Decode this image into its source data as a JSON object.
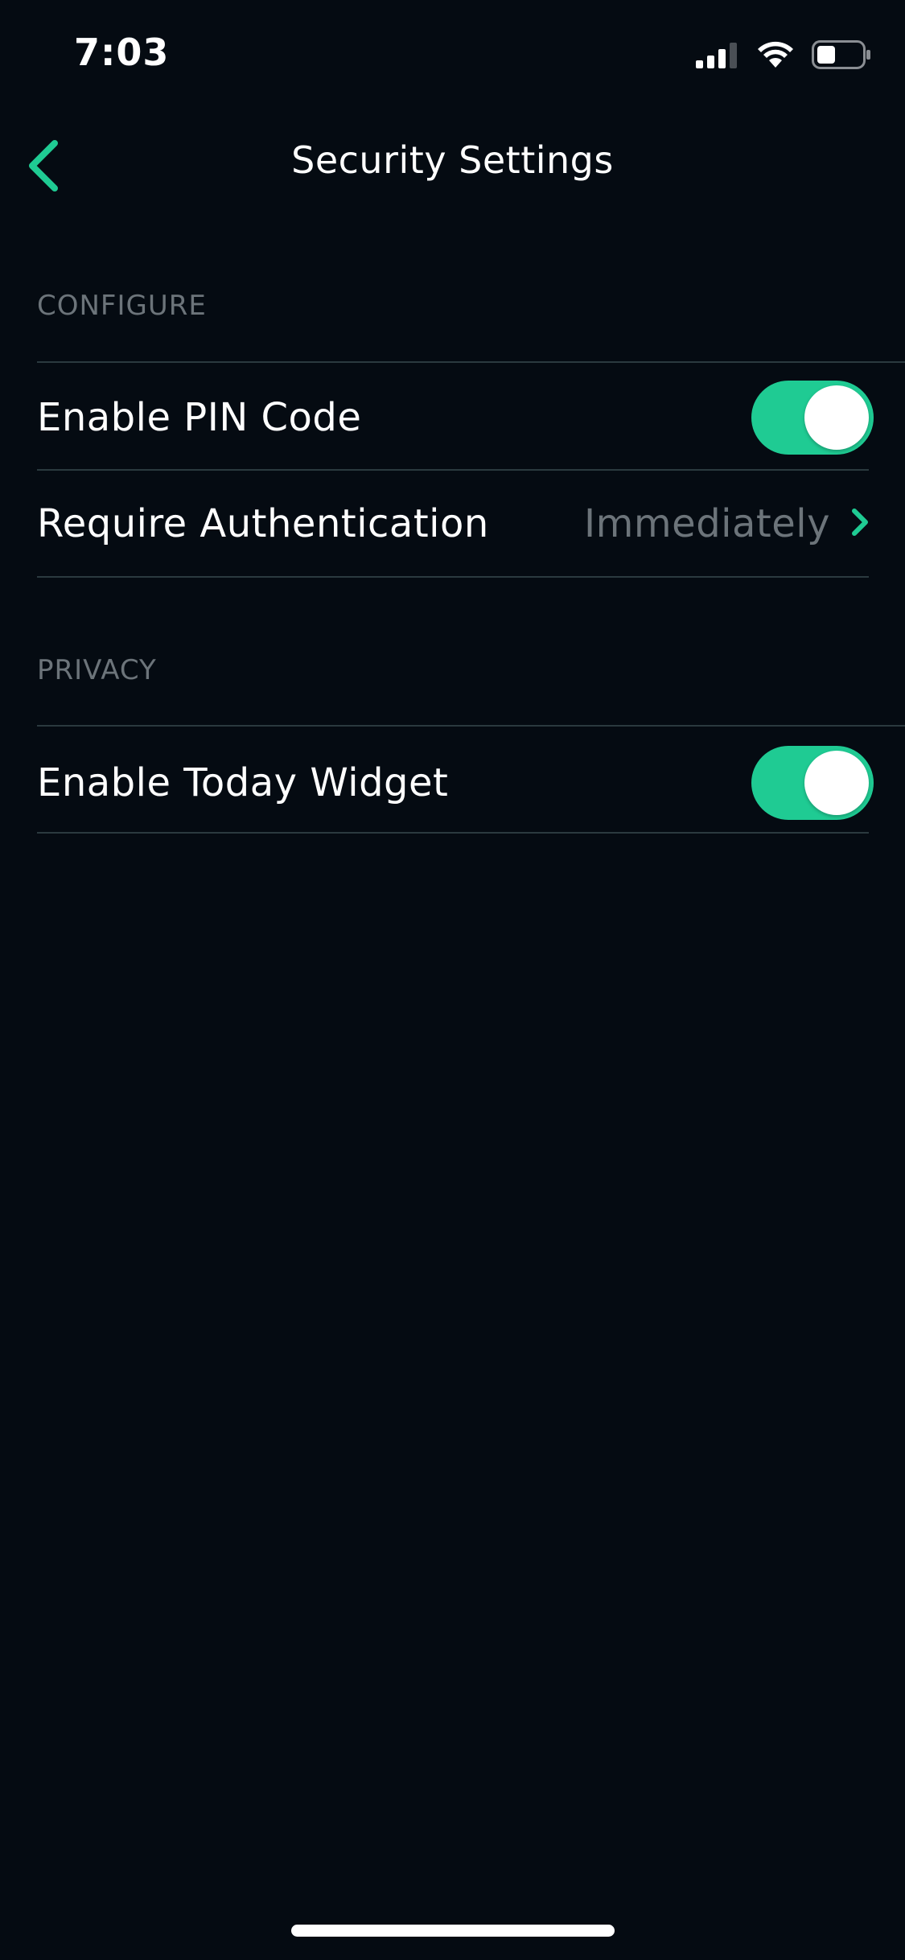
{
  "status_bar": {
    "time": "7:03",
    "icons": [
      "cellular-signal-icon",
      "wifi-icon",
      "battery-icon"
    ]
  },
  "nav": {
    "back_icon": "chevron-left-icon",
    "title": "Security Settings"
  },
  "sections": [
    {
      "header": "CONFIGURE",
      "rows": [
        {
          "label": "Enable PIN Code",
          "type": "toggle",
          "value": true
        },
        {
          "label": "Require Authentication",
          "type": "disclosure",
          "value": "Immediately"
        }
      ]
    },
    {
      "header": "PRIVACY",
      "rows": [
        {
          "label": "Enable Today Widget",
          "type": "toggle",
          "value": true
        }
      ]
    }
  ],
  "colors": {
    "background": "#050b12",
    "accent": "#1fcb93",
    "secondary_text": "#6c747a",
    "divider": "#2b3a3f"
  }
}
